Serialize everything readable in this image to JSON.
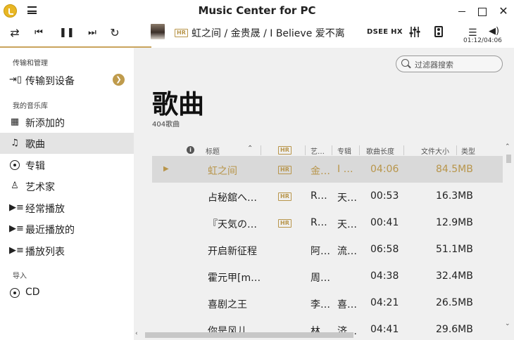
{
  "app": {
    "title": "Music Center for PC"
  },
  "window": {
    "minimize": "—",
    "maximize": "□",
    "close": "✕"
  },
  "player": {
    "now_playing": "虹之间 / 金贵晟 / I Believe 爱不离",
    "hr_badge": "HR",
    "dsee_label": "DSEE HX",
    "elapsed_time": "01:12/04:06",
    "progress_fraction": 0.29,
    "icons": {
      "repeat": "repeat-icon",
      "prev": "previous-icon",
      "pause": "pause-icon",
      "next": "next-icon",
      "shuffle": "shuffle-icon",
      "equalizer": "equalizer-icon",
      "speaker": "speaker-device-icon",
      "list": "playlist-icon",
      "volume": "volume-icon"
    }
  },
  "sidebar": {
    "section_transfer": "传输和管理",
    "transfer_item": "传输到设备",
    "section_library": "我的音乐库",
    "items": [
      {
        "label": "新添加的",
        "icon": "calendar-icon"
      },
      {
        "label": "歌曲",
        "icon": "music-note-icon",
        "active": true
      },
      {
        "label": "专辑",
        "icon": "album-icon"
      },
      {
        "label": "艺术家",
        "icon": "artist-icon"
      },
      {
        "label": "经常播放",
        "icon": "frequent-play-icon"
      },
      {
        "label": "最近播放的",
        "icon": "recent-play-icon"
      },
      {
        "label": "播放列表",
        "icon": "playlist-icon"
      }
    ],
    "section_import": "导入",
    "import_item": "CD"
  },
  "main": {
    "filter_placeholder": "过滤器搜索",
    "page_title": "歌曲",
    "song_count": "404歌曲",
    "columns": {
      "title": "标题",
      "hr": "HR",
      "artist": "艺…",
      "album": "专辑",
      "length": "歌曲长度",
      "size": "文件大小",
      "type": "类型"
    },
    "rows": [
      {
        "title": "虹之间",
        "hr": true,
        "artist": "金…",
        "album": "I …",
        "length": "04:06",
        "size": "84.5MB",
        "playing": true
      },
      {
        "title": "占秘舘へ…",
        "hr": true,
        "artist": "R…",
        "album": "天…",
        "length": "00:53",
        "size": "16.3MB"
      },
      {
        "title": "『天気の…",
        "hr": true,
        "artist": "R…",
        "album": "天…",
        "length": "00:41",
        "size": "12.9MB"
      },
      {
        "title": "开启新征程",
        "hr": false,
        "artist": "阿…",
        "album": "流…",
        "length": "06:58",
        "size": "51.1MB"
      },
      {
        "title": "霍元甲[m…",
        "hr": false,
        "artist": "周…",
        "album": "",
        "length": "04:38",
        "size": "32.4MB"
      },
      {
        "title": "喜剧之王",
        "hr": false,
        "artist": "李…",
        "album": "喜…",
        "length": "04:21",
        "size": "26.5MB"
      },
      {
        "title": "你是风儿",
        "hr": false,
        "artist": "林…",
        "album": "济…",
        "length": "04:41",
        "size": "29.6MB"
      }
    ]
  }
}
